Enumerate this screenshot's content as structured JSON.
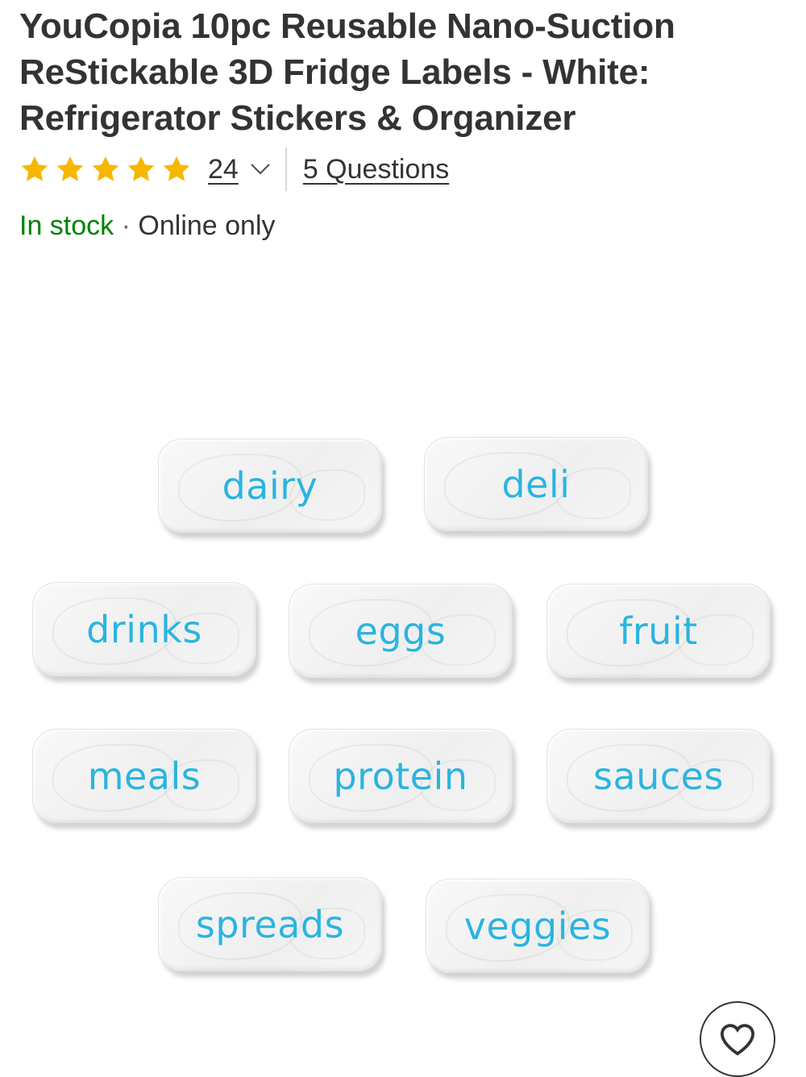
{
  "product": {
    "title": "YouCopia 10pc Reusable Nano-Suction ReStickable 3D Fridge Labels - White: Refrigerator Stickers & Organizer"
  },
  "rating": {
    "stars": 5,
    "review_count": "24",
    "questions_label": "5 Questions",
    "star_color": "#F5B700"
  },
  "availability": {
    "status": "In stock",
    "separator": "·",
    "channel": "Online only",
    "status_color": "#008300"
  },
  "image": {
    "labels": [
      "dairy",
      "deli",
      "drinks",
      "eggs",
      "fruit",
      "meals",
      "protein",
      "sauces",
      "spreads",
      "veggies"
    ],
    "label_text_color": "#2BB4E0"
  },
  "actions": {
    "favorite_icon": "heart-icon"
  }
}
